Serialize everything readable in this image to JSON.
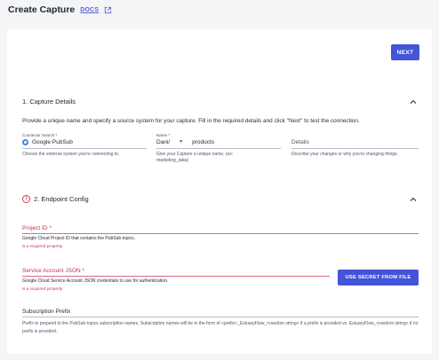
{
  "header": {
    "title": "Create Capture",
    "docs_label": "DOCS"
  },
  "toolbar": {
    "next_label": "NEXT"
  },
  "capture_details": {
    "title": "1. Capture Details",
    "description": "Provide a unique name and specify a source system for your capture. Fill in the required details and click \"Next\" to test the connection.",
    "connector": {
      "label": "Connector Search *",
      "value": "Google PubSub",
      "helper": "Choose the external system you're connecting to."
    },
    "name": {
      "label": "Name *",
      "prefix": "Dani/",
      "value": "products",
      "helper": "Give your Capture a unique name, (ex: marketing_data)"
    },
    "details": {
      "placeholder": "Details",
      "helper": "Describe your changes or why you're changing things."
    }
  },
  "endpoint_config": {
    "title": "2. Endpoint Config",
    "project_id": {
      "label": "Project ID *",
      "helper": "Google Cloud Project ID that contains the PubSub topics.",
      "error": "is a required property"
    },
    "service_account": {
      "label": "Service Account JSON *",
      "helper": "Google Cloud Service Account JSON credentials to use for authentication.",
      "error": "is a required property",
      "button_label": "USE SECRET FROM FILE"
    },
    "subscription_prefix": {
      "label": "Subscription Prefix",
      "helper": "Prefix to prepend to the PubSub topics subscription names. Subscription names will be in the form of <prefix>_EstuaryFlow_<random string> if a prefix is provided vs. EstuaryFlow_<random string> if no prefix is provided."
    }
  },
  "colors": {
    "accent": "#4354d8",
    "error": "#c0364a",
    "link": "#5a60d4"
  }
}
